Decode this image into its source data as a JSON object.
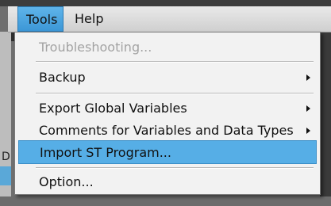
{
  "menubar": {
    "items": [
      {
        "label": "Tools"
      },
      {
        "label": "Help"
      }
    ]
  },
  "menu": {
    "items": [
      {
        "label": "Troubleshooting...",
        "disabled": true
      },
      {
        "label": "Backup",
        "submenu": true
      },
      {
        "label": "Export Global Variables",
        "submenu": true
      },
      {
        "label": "Comments for Variables and Data Types",
        "submenu": true
      },
      {
        "label": "Import ST Program...",
        "highlighted": true
      },
      {
        "label": "Option..."
      }
    ]
  },
  "background": {
    "left_char": "D"
  },
  "colors": {
    "highlight": "#56aee6",
    "menubar_active": "#4aa6e0",
    "disabled_text": "#a3a3a3"
  }
}
